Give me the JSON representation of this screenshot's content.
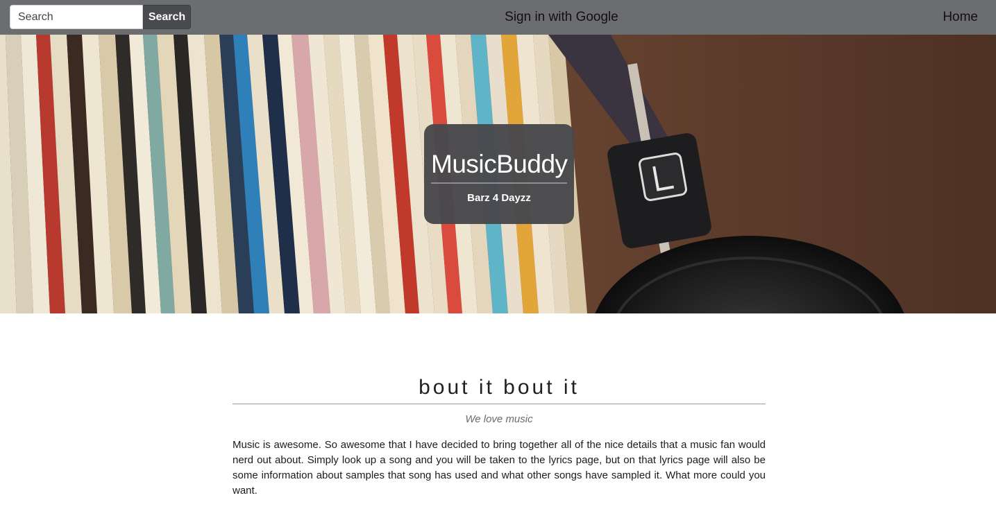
{
  "navbar": {
    "search_placeholder": "Search",
    "search_button": "Search",
    "signin_link": "Sign in with Google",
    "home_link": "Home"
  },
  "hero": {
    "title": "MusicBuddy",
    "subtitle": "Barz 4 Dayzz"
  },
  "main": {
    "heading": "bout it bout it",
    "tagline": "We love music",
    "body": "Music is awesome. So awesome that I have decided to bring together all of the nice details that a music fan would nerd out about. Simply look up a song and you will be taken to the lyrics page, but on that lyrics page will also be some information about samples that song has used and what other songs have sampled it. What more could you want."
  },
  "colors": {
    "navbar_bg": "#6c6d70",
    "card_bg": "#48484c",
    "hero_bg": "#5a3b2b"
  }
}
